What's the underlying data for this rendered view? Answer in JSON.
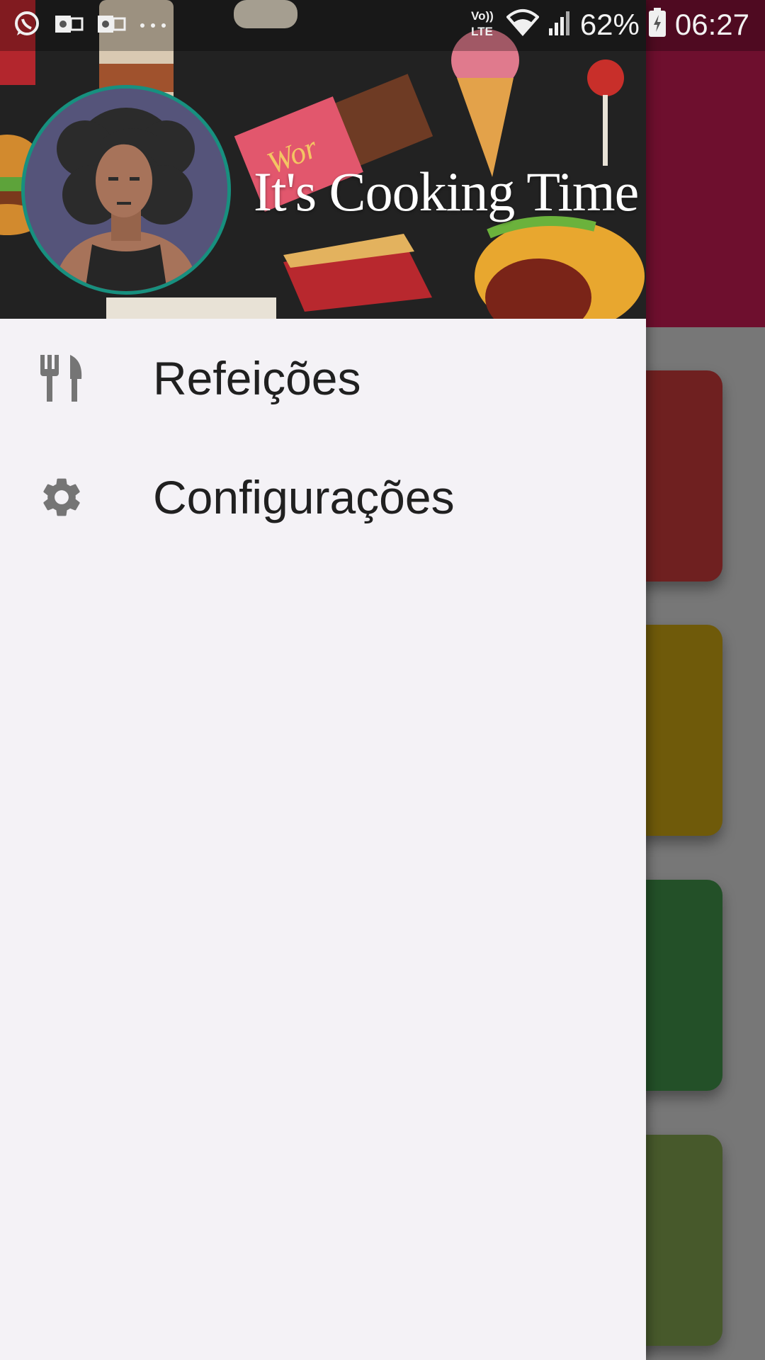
{
  "status_bar": {
    "battery_percent": "62%",
    "time": "06:27",
    "network_label_top": "Vo))",
    "network_label_bottom": "LTE",
    "left_icons": [
      "whatsapp-icon",
      "outlook-icon",
      "outlook-icon",
      "more-notifications-icon"
    ],
    "right_icons": [
      "volte-icon",
      "wifi-icon",
      "signal-icon",
      "battery-charging-icon"
    ]
  },
  "drawer": {
    "header": {
      "title": "It's Cooking Time",
      "avatar_icon": "avatar-woman-icon",
      "background": "food-illustration"
    },
    "menu": [
      {
        "label": "Refeições",
        "icon": "restaurant-icon"
      },
      {
        "label": "Configurações",
        "icon": "gear-icon"
      }
    ]
  },
  "colors": {
    "toolbar": "#6e0f2e",
    "drawer_background": "#f4f2f6",
    "avatar_border": "#17907f",
    "icon_gray": "#757575",
    "card_red": "#6f2020",
    "card_yellow": "#6f5a0a",
    "card_green": "#235028",
    "card_olive": "#47592b"
  }
}
